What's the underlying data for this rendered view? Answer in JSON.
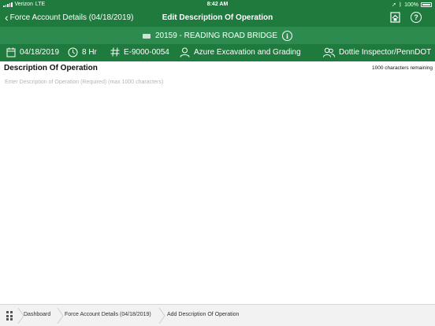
{
  "status_bar": {
    "carrier": "Verizon",
    "network": "LTE",
    "time": "8:42 AM",
    "battery_percent": "100%"
  },
  "nav": {
    "back_label": "Force Account Details (04/18/2019)",
    "title": "Edit Description Of Operation",
    "home_icon": "home-icon",
    "help_glyph": "?"
  },
  "project": {
    "label": "20159 - READING ROAD BRIDGE",
    "info_glyph": "i"
  },
  "info_bar": {
    "date": "04/18/2019",
    "duration": "8 Hr",
    "equipment_number": "E-9000-0054",
    "contractor": "Azure Excavation and Grading",
    "inspector": "Dottie Inspector/PennDOT"
  },
  "editor": {
    "title": "Description Of Operation",
    "chars_remaining": "1000 characters remaining",
    "placeholder": "Enter Description of Operation (Required) (max 1000 characters)",
    "value": ""
  },
  "breadcrumb": {
    "items": [
      "Dashboard",
      "Force Account Details (04/18/2019)",
      "Add Description Of Operation"
    ]
  },
  "colors": {
    "nav_green": "#1f7a3e",
    "project_green": "#2e8b4f",
    "breadcrumb_bg": "#f2f2f2"
  }
}
